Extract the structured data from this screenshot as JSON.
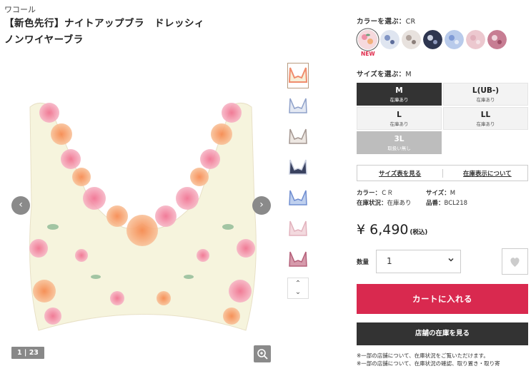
{
  "brand": "ワコール",
  "title_line1": "【新色先行】ナイトアップブラ　ドレッシィ",
  "title_line2": "ノンワイヤーブラ",
  "gallery": {
    "prev_glyph": "‹",
    "next_glyph": "›",
    "counter": "1 | 23",
    "up_glyph": "⌃",
    "down_glyph": "⌄"
  },
  "color_section": {
    "label": "カラーを選ぶ：",
    "selected": "CR",
    "new_badge": "NEW",
    "swatches": [
      {
        "name": "CR",
        "color": "#f6d9dd",
        "accent": "#6aa07a"
      },
      {
        "name": "swatch-2",
        "color": "#dfe5f0",
        "accent": "#5d6d9a"
      },
      {
        "name": "swatch-3",
        "color": "#e8e2de",
        "accent": "#8b7f7a"
      },
      {
        "name": "swatch-4",
        "color": "#2e3650",
        "accent": "#c9cfe0"
      },
      {
        "name": "swatch-5",
        "color": "#b9cbeb",
        "accent": "#7f9ad6"
      },
      {
        "name": "swatch-6",
        "color": "#ecc8cf",
        "accent": "#e1b0bb"
      },
      {
        "name": "swatch-7",
        "color": "#c77d93",
        "accent": "#f0d6dd"
      }
    ]
  },
  "size_section": {
    "label": "サイズを選ぶ：",
    "selected": "M",
    "sizes": [
      {
        "size": "M",
        "status": "在庫あり"
      },
      {
        "size": "L(UB-)",
        "status": "在庫あり"
      },
      {
        "size": "L",
        "status": "在庫あり"
      },
      {
        "size": "LL",
        "status": "在庫あり"
      },
      {
        "size": "3L",
        "status": "取扱い無し"
      }
    ]
  },
  "links": {
    "size_chart": "サイズ表を見る",
    "stock_display": "在庫表示について"
  },
  "info": {
    "color_label": "カラー：",
    "color_value": "ＣＲ",
    "size_label": "サイズ：",
    "size_value": "M",
    "stock_label": "在庫状況：",
    "stock_value": "在庫あり",
    "sku_label": "品番：",
    "sku_value": "BCL218"
  },
  "price": {
    "amount": "¥ 6,490",
    "tax": "(税込)"
  },
  "quantity": {
    "label": "数量",
    "value": "1"
  },
  "buttons": {
    "cart": "カートに入れる",
    "store_stock": "店舗の在庫を見る"
  },
  "notes": {
    "line1": "※一部の店舗について、在庫状況をご覧いただけます。",
    "line2": "※一部の店舗について、在庫状況の確認、取り置き・取り寄"
  },
  "colors": {
    "accent_red": "#d9294f",
    "dark": "#333333",
    "disabled": "#bdbdbd"
  }
}
